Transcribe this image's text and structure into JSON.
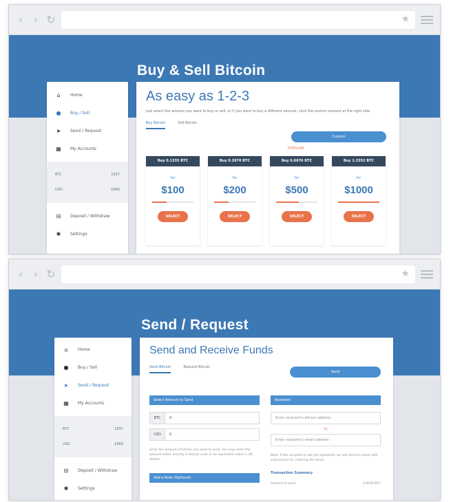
{
  "screen1": {
    "hero_title": "Buy & Sell Bitcoin",
    "sidebar": {
      "items_top": [
        {
          "icon": "home-icon",
          "glyph": "⌂",
          "label": "Home"
        },
        {
          "icon": "bitcoin-icon",
          "glyph": "●",
          "label": "Buy / Sell",
          "active": true
        },
        {
          "icon": "send-icon",
          "glyph": "➤",
          "label": "Send / Request"
        },
        {
          "icon": "accounts-icon",
          "glyph": "▦",
          "label": "My Accounts"
        }
      ],
      "balances": [
        {
          "label": "BTC",
          "value": "1837"
        },
        {
          "label": "USD",
          "value": "$960"
        }
      ],
      "items_bottom": [
        {
          "icon": "deposit-icon",
          "glyph": "⊟",
          "label": "Deposit / Withdraw"
        },
        {
          "icon": "settings-icon",
          "glyph": "✱",
          "label": "Settings"
        }
      ]
    },
    "card": {
      "title": "As easy as 1-2-3",
      "subtitle": "Just select the amount you want to buy or sell, or if you want to buy a different amount, click the custom amount at the right side",
      "tabs": [
        "Buy Bitcoin",
        "Sell Bitcoin"
      ],
      "pill_label": "Custom",
      "popular_label": "POPULAR",
      "plans": [
        {
          "head": "Buy 0.1335 BTC",
          "for": "for",
          "price": "$100",
          "fill": 0.35,
          "button": "SELECT"
        },
        {
          "head": "Buy 0.2670 BTC",
          "for": "for",
          "price": "$200",
          "fill": 0.35,
          "button": "SELECT"
        },
        {
          "head": "Buy 0.6676 BTC",
          "for": "for",
          "price": "$500",
          "fill": 0.55,
          "button": "SELECT"
        },
        {
          "head": "Buy 1.3352 BTC",
          "for": "for",
          "price": "$1000",
          "fill": 1.0,
          "button": "SELECT"
        }
      ]
    }
  },
  "screen2": {
    "hero_title": "Send / Request",
    "sidebar": {
      "items_top": [
        {
          "icon": "home-icon",
          "glyph": "⌂",
          "label": "Home"
        },
        {
          "icon": "bitcoin-icon",
          "glyph": "●",
          "label": "Buy / Sell"
        },
        {
          "icon": "send-icon",
          "glyph": "➤",
          "label": "Send / Request",
          "active": true
        },
        {
          "icon": "accounts-icon",
          "glyph": "▦",
          "label": "My Accounts"
        }
      ],
      "balances": [
        {
          "label": "BTC",
          "value": "1837"
        },
        {
          "label": "USD",
          "value": "$960"
        }
      ],
      "items_bottom": [
        {
          "icon": "deposit-icon",
          "glyph": "⊟",
          "label": "Deposit / Withdraw"
        },
        {
          "icon": "settings-icon",
          "glyph": "✱",
          "label": "Settings"
        }
      ]
    },
    "card": {
      "title": "Send and Receive Funds",
      "tabs": [
        "Send Bitcoin",
        "Request Bitcoin"
      ],
      "pill_label": "Send",
      "amount_header": "Select Amount to Send",
      "amounts": [
        {
          "currency": "BTC",
          "value": "0"
        },
        {
          "currency": "USD",
          "value": "0"
        }
      ],
      "amount_note": "Enter the amount of bitcoin you want to send. You may enter the amount either directly in bitcoin units or its equivalent value in US dollars.",
      "add_note_header": "Add a Note (Optional)",
      "recipient_header": "Recipient",
      "recipient_placeholder_1": "Enter recipient's bitcoin address",
      "or_label": "or",
      "recipient_placeholder_2": "Enter recipient's email address",
      "recipient_note": "Note: If the recipient is not yet registered, we will send an email with instructions for claiming the funds.",
      "summary_title": "Transaction Summary",
      "summary_label": "Amount to send",
      "summary_value": "0.0000 BTC"
    }
  }
}
